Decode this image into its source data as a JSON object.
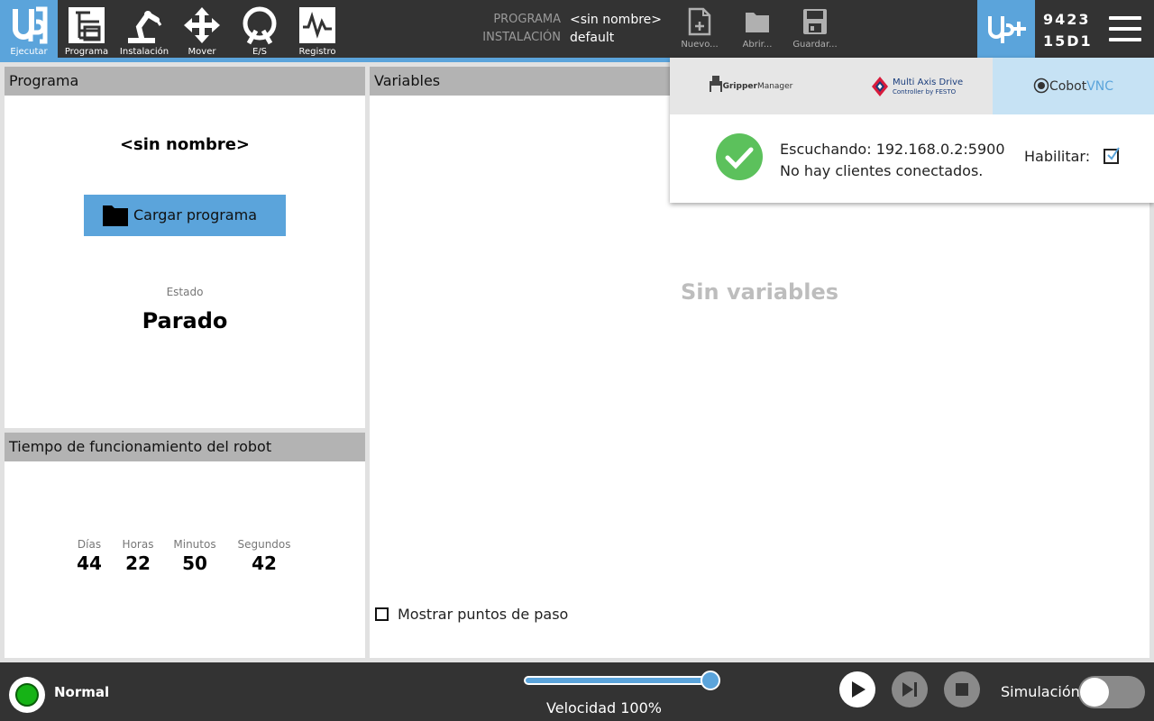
{
  "nav": {
    "items": [
      {
        "label": "Ejecutar",
        "icon": "ur-logo-icon",
        "active": true
      },
      {
        "label": "Programa",
        "icon": "program-tree-icon"
      },
      {
        "label": "Instalación",
        "icon": "robot-arm-icon"
      },
      {
        "label": "Mover",
        "icon": "move-arrows-icon"
      },
      {
        "label": "E/S",
        "icon": "io-icon"
      },
      {
        "label": "Registro",
        "icon": "log-chart-icon"
      }
    ]
  },
  "program_info": {
    "program_label": "PROGRAMA",
    "program_value": "<sin nombre>",
    "installation_label": "INSTALACIÓN",
    "installation_value": "default"
  },
  "file_actions": {
    "new_label": "Nuevo...",
    "open_label": "Abrir...",
    "save_label": "Guardar..."
  },
  "serial": {
    "line1": "9423",
    "line2": "15D1"
  },
  "program_panel": {
    "title": "Programa",
    "program_name": "<sin nombre>",
    "load_button": "Cargar programa",
    "state_label": "Estado",
    "state_value": "Parado"
  },
  "uptime_panel": {
    "title": "Tiempo de funcionamiento del robot",
    "columns": [
      {
        "label": "Días",
        "value": "44"
      },
      {
        "label": "Horas",
        "value": "22"
      },
      {
        "label": "Minutos",
        "value": "50"
      },
      {
        "label": "Segundos",
        "value": "42"
      }
    ]
  },
  "variables_panel": {
    "title": "Variables",
    "empty_text": "Sin variables",
    "show_waypoints_label": "Mostrar puntos de paso",
    "show_waypoints_checked": false
  },
  "urcap_popup": {
    "tabs": [
      {
        "name": "GripperManager",
        "part1": "Gripper",
        "part2": "Manager"
      },
      {
        "name": "Multi Axis Drive",
        "line1": "Multi Axis Drive",
        "line2": "Controller by FESTO"
      },
      {
        "name": "CobotVNC",
        "part1": "Cobot",
        "part2": "VNC",
        "active": true
      }
    ],
    "status_line1": "Escuchando: 192.168.0.2:5900",
    "status_line2": "No hay clientes conectados.",
    "enable_label": "Habilitar:",
    "enable_checked": true
  },
  "bottom": {
    "status": "Normal",
    "speed_label": "Velocidad 100%",
    "speed_percent": 100,
    "simulation_label": "Simulación",
    "simulation_on": false
  },
  "colors": {
    "accent": "#5ba4db",
    "bar": "#333333",
    "status_green": "#16b316",
    "ok_green": "#5cc15c"
  }
}
